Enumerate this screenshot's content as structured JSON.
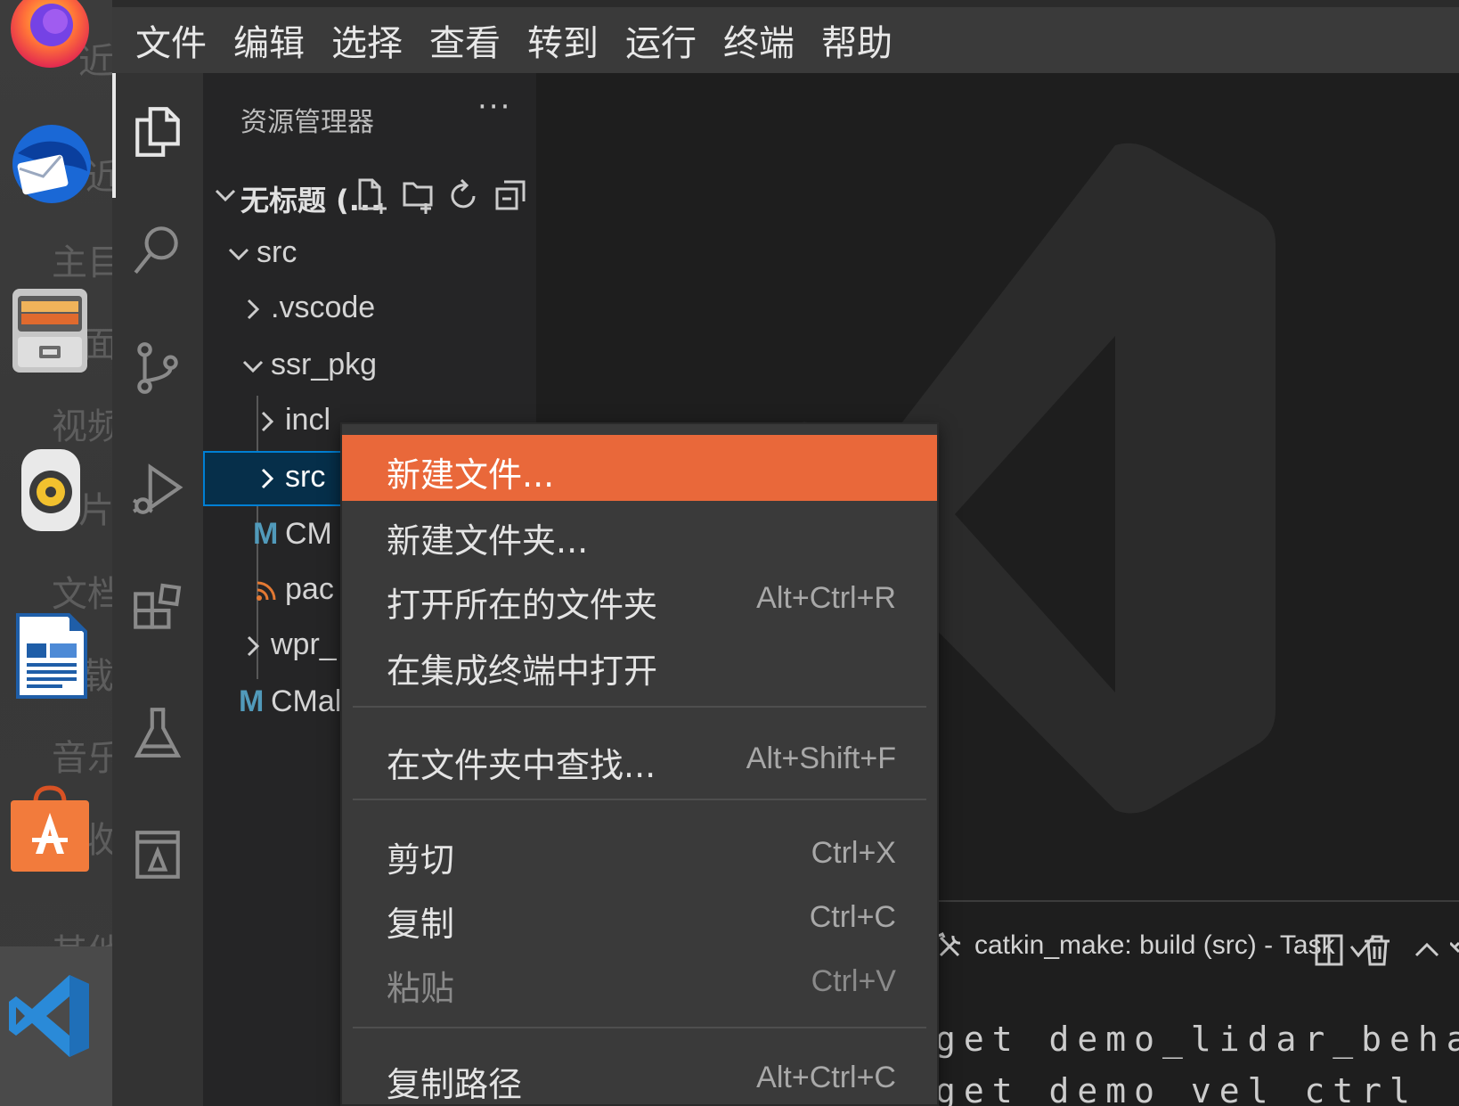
{
  "dock": {
    "ghost_labels": [
      "近",
      "主目",
      "面",
      "视频",
      "片",
      "文档",
      "载",
      "音乐",
      "收",
      "其他"
    ],
    "apps": [
      "firefox-icon",
      "thunderbird-icon",
      "files-icon",
      "rhythmbox-icon",
      "libreoffice-writer-icon",
      "ubuntu-software-icon",
      "vscode-icon"
    ]
  },
  "menubar": {
    "items": [
      "文件",
      "编辑",
      "选择",
      "查看",
      "转到",
      "运行",
      "终端",
      "帮助"
    ]
  },
  "sidebar": {
    "title": "资源管理器",
    "more": "···",
    "workspace": "无标题 (...",
    "tree": {
      "src": "src",
      "vscode": ".vscode",
      "ssr_pkg": "ssr_pkg",
      "include": "incl",
      "src_inner": "src",
      "cmake_badge": "M",
      "cmake_inner": "CM",
      "package": "pac",
      "wpr": "wpr_",
      "cmake_root_badge": "M",
      "cmake_root": "CMal"
    }
  },
  "context_menu": {
    "items": [
      {
        "label": "新建文件...",
        "shortcut": ""
      },
      {
        "label": "新建文件夹...",
        "shortcut": ""
      },
      {
        "label": "打开所在的文件夹",
        "shortcut": "Alt+Ctrl+R"
      },
      {
        "label": "在集成终端中打开",
        "shortcut": ""
      },
      {
        "label": "在文件夹中查找...",
        "shortcut": "Alt+Shift+F"
      },
      {
        "label": "剪切",
        "shortcut": "Ctrl+X"
      },
      {
        "label": "复制",
        "shortcut": "Ctrl+C"
      },
      {
        "label": "粘贴",
        "shortcut": "Ctrl+V"
      },
      {
        "label": "复制路径",
        "shortcut": "Alt+Ctrl+C"
      }
    ]
  },
  "panel": {
    "task_label": "catkin_make: build (src) - Task",
    "terminal_lines": [
      "get  demo_lidar_behavior",
      "get  demo vel  ctrl"
    ]
  },
  "colors": {
    "menu_highlight": "#e9683a",
    "selection": "#062f4a",
    "focus_border": "#007fd4",
    "cmake_badge": "#519aba",
    "rss_icon": "#e37933"
  }
}
